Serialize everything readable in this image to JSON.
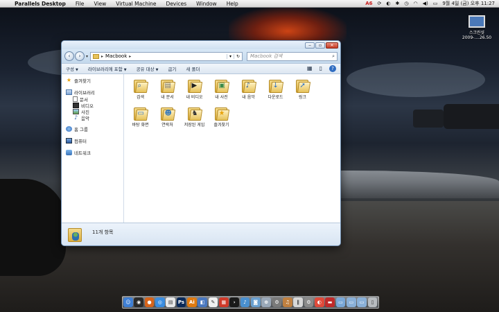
{
  "menubar": {
    "app_name": "Parallels Desktop",
    "items": [
      "File",
      "View",
      "Virtual Machine",
      "Devices",
      "Window",
      "Help"
    ],
    "status": {
      "adobe_badge": "6",
      "date": "9월 4일 (금) 오후",
      "time": "11:27"
    }
  },
  "desktop_item": {
    "label_line1": "스크린샷",
    "label_line2": "2009-....26.50"
  },
  "window": {
    "address": {
      "path": "Macbook",
      "dropdown_glyph": "▾",
      "refresh_glyph": "↻"
    },
    "search_placeholder": "Macbook 검색",
    "toolbar": {
      "organize": "구성",
      "include_in_library": "라이브러리에 포함",
      "share_with": "공유 대상",
      "burn": "굽기",
      "new_folder": "새 폴더"
    },
    "navpane": {
      "favorites": "즐겨찾기",
      "libraries": "라이브러리",
      "library_items": [
        "문서",
        "비디오",
        "사진",
        "음악"
      ],
      "homegroup": "홈 그룹",
      "computer": "컴퓨터",
      "network": "네트워크"
    },
    "folders": [
      {
        "label": "검색",
        "icon": "search-icon"
      },
      {
        "label": "내 문서",
        "icon": "document-icon"
      },
      {
        "label": "내 비디오",
        "icon": "video-icon"
      },
      {
        "label": "내 사진",
        "icon": "picture-icon"
      },
      {
        "label": "내 음악",
        "icon": "music-icon"
      },
      {
        "label": "다운로드",
        "icon": "download-icon"
      },
      {
        "label": "링크",
        "icon": "link-icon"
      },
      {
        "label": "바탕 화면",
        "icon": "desktop-icon"
      },
      {
        "label": "연락처",
        "icon": "contacts-icon"
      },
      {
        "label": "저장된 게임",
        "icon": "games-icon"
      },
      {
        "label": "즐겨찾기",
        "icon": "star-icon"
      }
    ],
    "details": {
      "item_count": "11개 항목"
    }
  },
  "dock": {
    "items": [
      {
        "name": "finder",
        "color": "#3f7fd4",
        "glyph": "☺"
      },
      {
        "name": "dashboard",
        "color": "#2a2a2a",
        "glyph": "◉"
      },
      {
        "name": "firefox",
        "color": "#d8641a",
        "glyph": "●"
      },
      {
        "name": "safari",
        "color": "#3b8de0",
        "glyph": "◎"
      },
      {
        "name": "ical",
        "color": "#e8e8e8",
        "glyph": "▤"
      },
      {
        "name": "photoshop",
        "color": "#0a2a5a",
        "glyph": "Ps"
      },
      {
        "name": "illustrator",
        "color": "#e07a10",
        "glyph": "Ai"
      },
      {
        "name": "preview",
        "color": "#4a78c0",
        "glyph": "◧"
      },
      {
        "name": "textedit",
        "color": "#f0f0f0",
        "glyph": "✎"
      },
      {
        "name": "calendar",
        "color": "#d03a2a",
        "glyph": "▦"
      },
      {
        "name": "terminal",
        "color": "#1a1a1a",
        "glyph": "›"
      },
      {
        "name": "itunes",
        "color": "#4a90d0",
        "glyph": "♪"
      },
      {
        "name": "iphoto",
        "color": "#6aa0d0",
        "glyph": "◙"
      },
      {
        "name": "network-utility",
        "color": "#9aa8b8",
        "glyph": "⊕"
      },
      {
        "name": "preferences",
        "color": "#7a7a7a",
        "glyph": "⚙"
      },
      {
        "name": "garageband",
        "color": "#c08040",
        "glyph": "♫"
      },
      {
        "name": "parallels",
        "color": "#d8d8d8",
        "glyph": "∥"
      },
      {
        "name": "system-prefs",
        "color": "#8a8a8a",
        "glyph": "⚙"
      },
      {
        "name": "chrome",
        "color": "#e04a3a",
        "glyph": "◐"
      },
      {
        "name": "windows-vm",
        "color": "#c02a2a",
        "glyph": "▬"
      },
      {
        "name": "app-folder",
        "color": "#7aa8d8",
        "glyph": "▭"
      },
      {
        "name": "documents-folder",
        "color": "#8ab0d8",
        "glyph": "▭"
      },
      {
        "name": "downloads-folder",
        "color": "#8ab0d8",
        "glyph": "▭"
      },
      {
        "name": "trash",
        "color": "#b8bcc0",
        "glyph": "▯"
      }
    ]
  }
}
